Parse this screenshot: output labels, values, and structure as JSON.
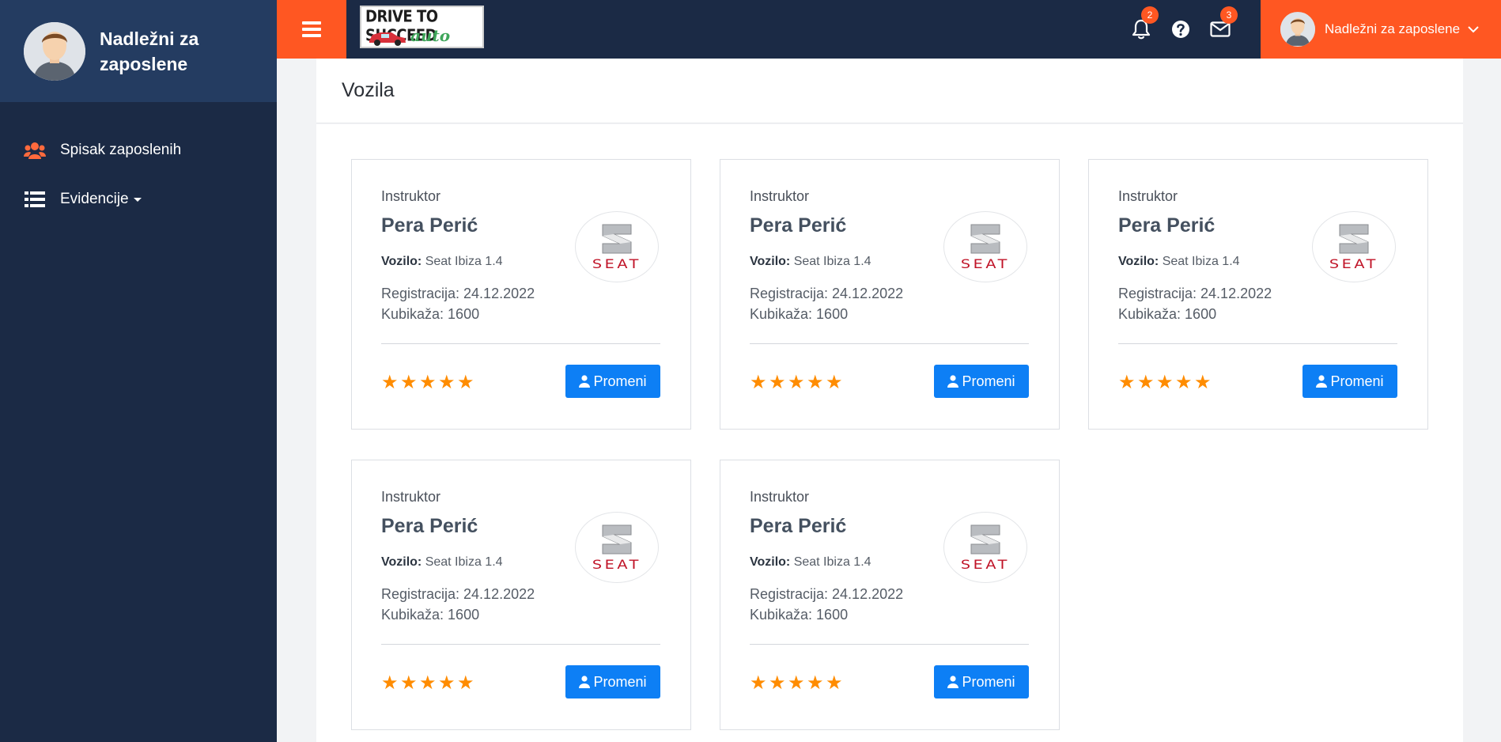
{
  "sidebar": {
    "user_name": "Nadležni za zaposlene",
    "items": [
      {
        "label": "Spisak zaposlenih",
        "icon": "users-icon"
      },
      {
        "label": "Evidencije",
        "icon": "list-icon"
      }
    ]
  },
  "topbar": {
    "logo_line1": "DRIVE TO SUCCEED",
    "logo_line2": "auto škola",
    "notifications_count": "2",
    "messages_count": "3",
    "user_name": "Nadležni za zaposlene",
    "accent_color": "#ff5722"
  },
  "page": {
    "title": "Vozila"
  },
  "cards": [
    {
      "role": "Instruktor",
      "name": "Pera Perić",
      "vehicle_label": "Vozilo:",
      "vehicle": " Seat Ibiza 1.4",
      "registration": "Registracija: 24.12.2022",
      "cc": "Kubikaža: 1600",
      "logo_text": "SEAT",
      "rating": 5,
      "button": "Promeni"
    },
    {
      "role": "Instruktor",
      "name": "Pera Perić",
      "vehicle_label": "Vozilo:",
      "vehicle": " Seat Ibiza 1.4",
      "registration": "Registracija: 24.12.2022",
      "cc": "Kubikaža: 1600",
      "logo_text": "SEAT",
      "rating": 5,
      "button": "Promeni"
    },
    {
      "role": "Instruktor",
      "name": "Pera Perić",
      "vehicle_label": "Vozilo:",
      "vehicle": " Seat Ibiza 1.4",
      "registration": "Registracija: 24.12.2022",
      "cc": "Kubikaža: 1600",
      "logo_text": "SEAT",
      "rating": 5,
      "button": "Promeni"
    },
    {
      "role": "Instruktor",
      "name": "Pera Perić",
      "vehicle_label": "Vozilo:",
      "vehicle": " Seat Ibiza 1.4",
      "registration": "Registracija: 24.12.2022",
      "cc": "Kubikaža: 1600",
      "logo_text": "SEAT",
      "rating": 5,
      "button": "Promeni"
    },
    {
      "role": "Instruktor",
      "name": "Pera Perić",
      "vehicle_label": "Vozilo:",
      "vehicle": " Seat Ibiza 1.4",
      "registration": "Registracija: 24.12.2022",
      "cc": "Kubikaža: 1600",
      "logo_text": "SEAT",
      "rating": 5,
      "button": "Promeni"
    }
  ]
}
